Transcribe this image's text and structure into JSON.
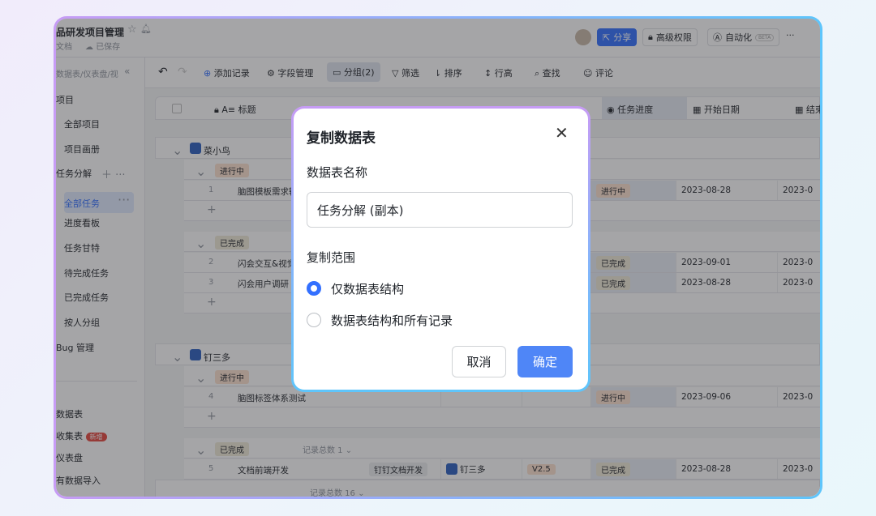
{
  "header": {
    "title": "品研发项目管理",
    "doc_type": "文档",
    "save_status": "已保存",
    "share": "分享",
    "permission": "高级权限",
    "automation": "自动化",
    "beta": "BETA",
    "more": "···"
  },
  "sidebar": {
    "search": "数据表/仪表盘/视",
    "items": [
      {
        "label": "项目"
      },
      {
        "label": "全部项目"
      },
      {
        "label": "项目画册"
      },
      {
        "label": "任务分解"
      },
      {
        "label": "全部任务"
      },
      {
        "label": "进度看板"
      },
      {
        "label": "任务甘特"
      },
      {
        "label": "待完成任务"
      },
      {
        "label": "已完成任务"
      },
      {
        "label": "按人分组"
      },
      {
        "label": "Bug 管理"
      }
    ],
    "bottom": [
      {
        "label": "数据表"
      },
      {
        "label": "收集表",
        "badge": "新增"
      },
      {
        "label": "仪表盘"
      },
      {
        "label": "有数据导入"
      }
    ]
  },
  "toolbar": {
    "add": "添加记录",
    "fields": "字段管理",
    "group": "分组(2)",
    "filter": "筛选",
    "sort": "排序",
    "row_height": "行高",
    "find": "查找",
    "comment": "评论"
  },
  "table": {
    "columns": [
      "标题",
      "任务进度",
      "开始日期",
      "结束"
    ],
    "groups": [
      {
        "owner": "菜小鸟",
        "sub": [
          {
            "status": "进行中",
            "rows": [
              {
                "n": "1",
                "title": "脑图模板需求输出",
                "progress": "进行中",
                "start": "2023-08-28",
                "end": "2023-0"
              }
            ]
          },
          {
            "status": "已完成",
            "rows": [
              {
                "n": "2",
                "title": "闪会交互&视觉设计",
                "progress": "已完成",
                "start": "2023-09-01",
                "end": "2023-0"
              },
              {
                "n": "3",
                "title": "闪会用户调研",
                "progress": "已完成",
                "start": "2023-08-28",
                "end": "2023-0"
              }
            ]
          }
        ]
      },
      {
        "owner": "钉三多",
        "sub": [
          {
            "status": "进行中",
            "rows": [
              {
                "n": "4",
                "title": "脑图标签体系测试",
                "progress": "进行中",
                "start": "2023-09-06",
                "end": "2023-0"
              }
            ]
          },
          {
            "status": "已完成",
            "count": "记录总数 1",
            "rows": [
              {
                "n": "5",
                "title": "文档前端开发",
                "project": "钉钉文档开发",
                "person": "钉三多",
                "version": "V2.5",
                "progress": "已完成",
                "start": "2023-08-28",
                "end": "2023-0"
              }
            ]
          }
        ]
      }
    ],
    "total": "记录总数 16"
  },
  "dialog": {
    "title": "复制数据表",
    "name_label": "数据表名称",
    "name_value": "任务分解 (副本)",
    "scope_label": "复制范围",
    "options": [
      "仅数据表结构",
      "数据表结构和所有记录"
    ],
    "selected": 0,
    "cancel": "取消",
    "confirm": "确定"
  }
}
